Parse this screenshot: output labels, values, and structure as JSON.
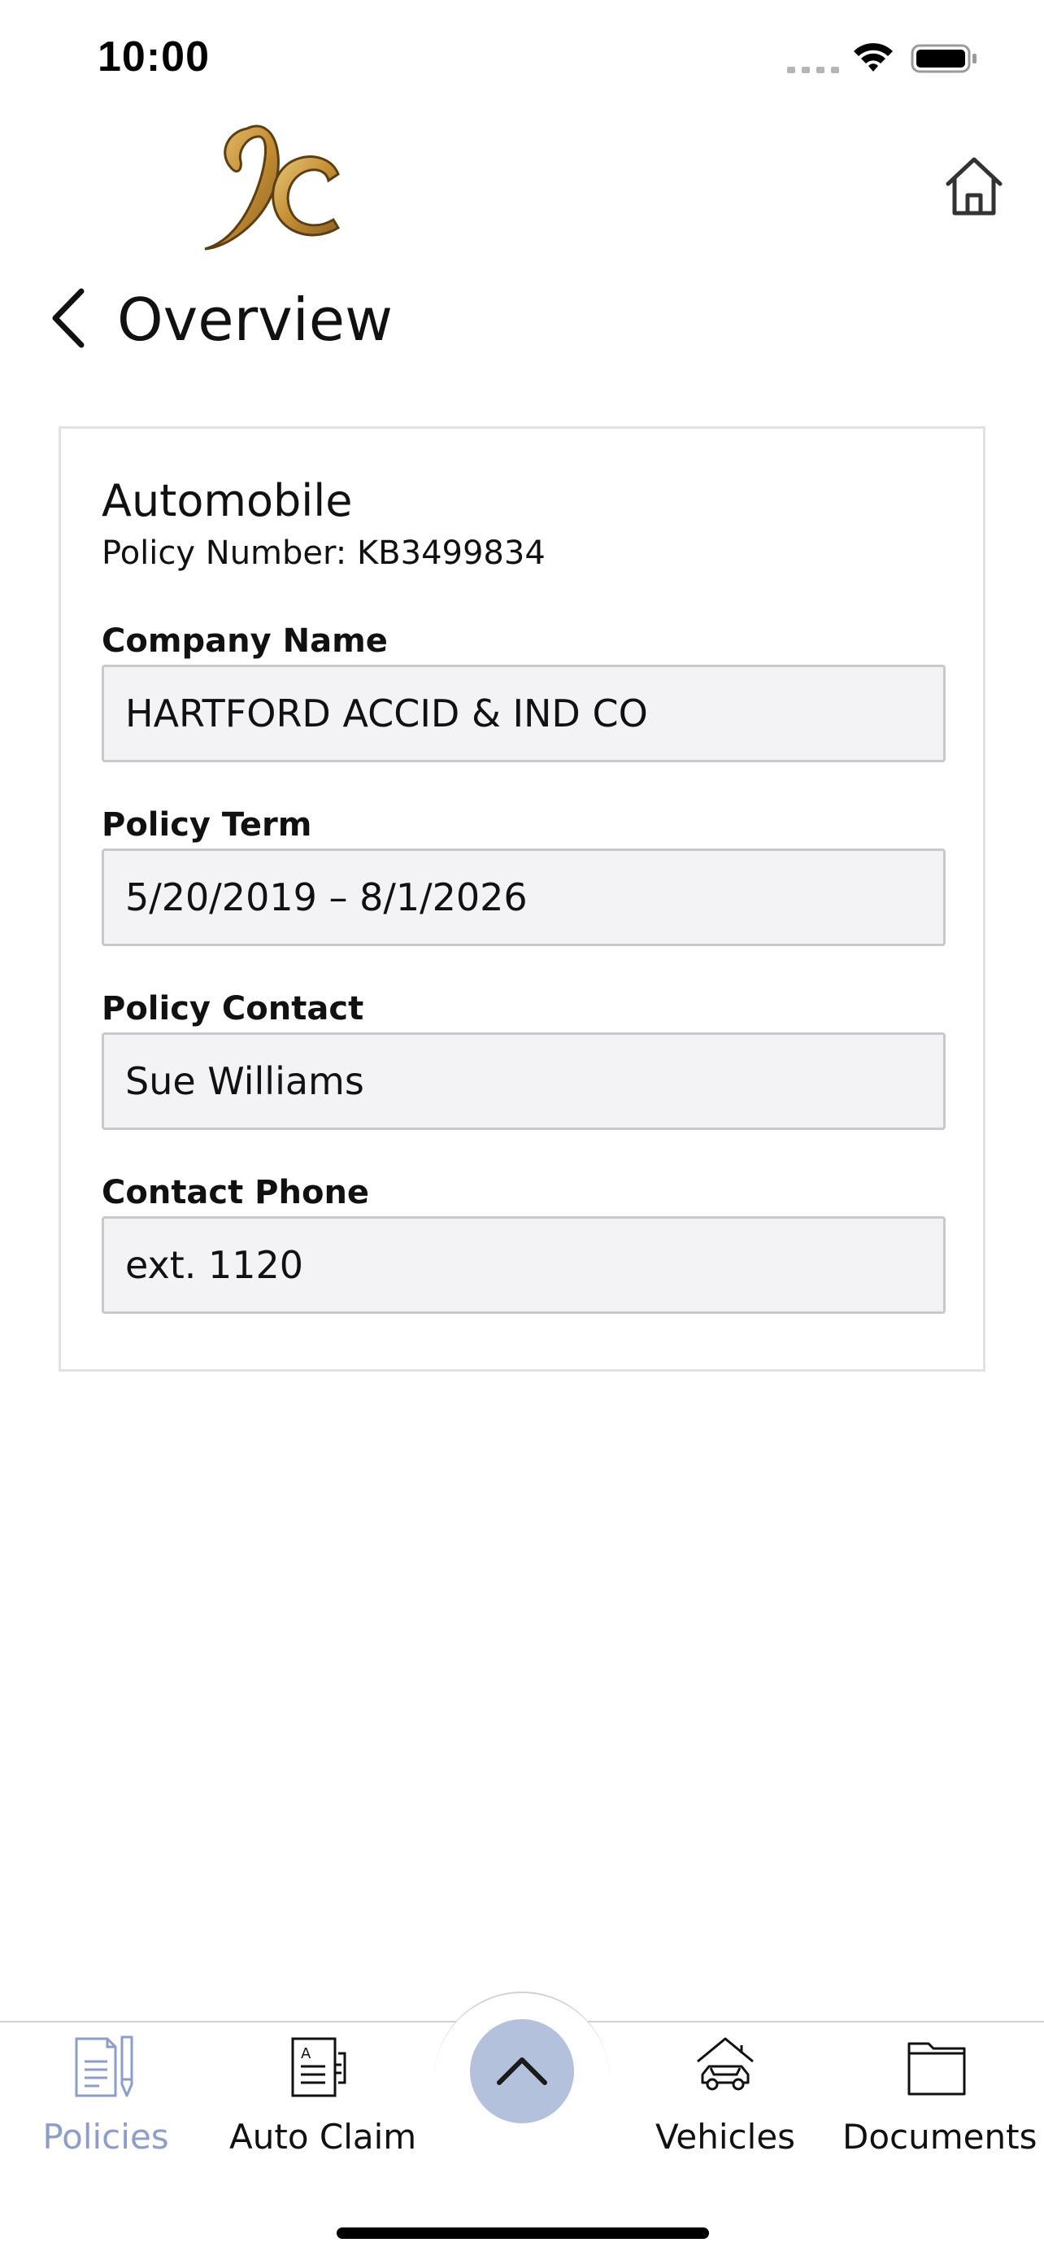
{
  "status_bar": {
    "time": "10:00"
  },
  "header": {
    "logo_icon": "kc-monogram-logo",
    "home_icon": "home-icon",
    "back_icon": "chevron-left-icon",
    "title": "Overview"
  },
  "policy_card": {
    "type": "Automobile",
    "policy_number": "Policy Number: KB3499834",
    "fields": [
      {
        "label": "Company Name",
        "value": "HARTFORD ACCID & IND CO"
      },
      {
        "label": "Policy Term",
        "value": "5/20/2019 – 8/1/2026"
      },
      {
        "label": "Policy Contact",
        "value": "Sue Williams"
      },
      {
        "label": "Contact Phone",
        "value": "ext. 1120"
      }
    ]
  },
  "tab_bar": {
    "tabs": [
      {
        "label": "Policies",
        "icon": "policy-document-icon",
        "active": true
      },
      {
        "label": "Auto Claim",
        "icon": "claim-form-icon",
        "active": false
      },
      {
        "label": "Vehicles",
        "icon": "car-garage-icon",
        "active": false
      },
      {
        "label": "Documents",
        "icon": "folder-icon",
        "active": false
      }
    ],
    "center_button_icon": "chevron-up-icon"
  },
  "colors": {
    "active_tab": "#8e9ecb",
    "fab_background": "#b3c1dc",
    "field_background": "#f3f3f5",
    "logo_gold": "#c79a3e"
  }
}
